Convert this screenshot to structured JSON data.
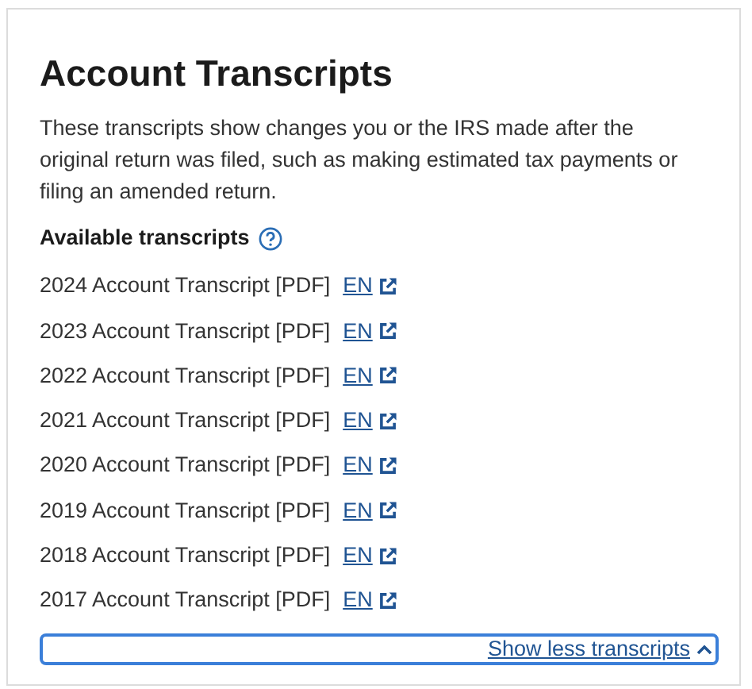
{
  "card": {
    "title": "Account Transcripts",
    "description": "These transcripts show changes you or the IRS made after the original return was filed, such as making estimated tax payments or filing an amended return.",
    "section_heading": "Available transcripts",
    "transcripts": [
      {
        "label": "2024 Account Transcript [PDF]",
        "link": "EN"
      },
      {
        "label": "2023 Account Transcript [PDF]",
        "link": "EN"
      },
      {
        "label": "2022 Account Transcript [PDF]",
        "link": "EN"
      },
      {
        "label": "2021 Account Transcript [PDF]",
        "link": "EN"
      },
      {
        "label": "2020 Account Transcript [PDF]",
        "link": "EN"
      },
      {
        "label": "2019 Account Transcript [PDF]",
        "link": "EN"
      },
      {
        "label": "2018 Account Transcript [PDF]",
        "link": "EN"
      },
      {
        "label": "2017 Account Transcript [PDF]",
        "link": "EN"
      }
    ],
    "toggle_button": {
      "label": "Show less transcripts",
      "focused": true,
      "expanded": true
    }
  }
}
